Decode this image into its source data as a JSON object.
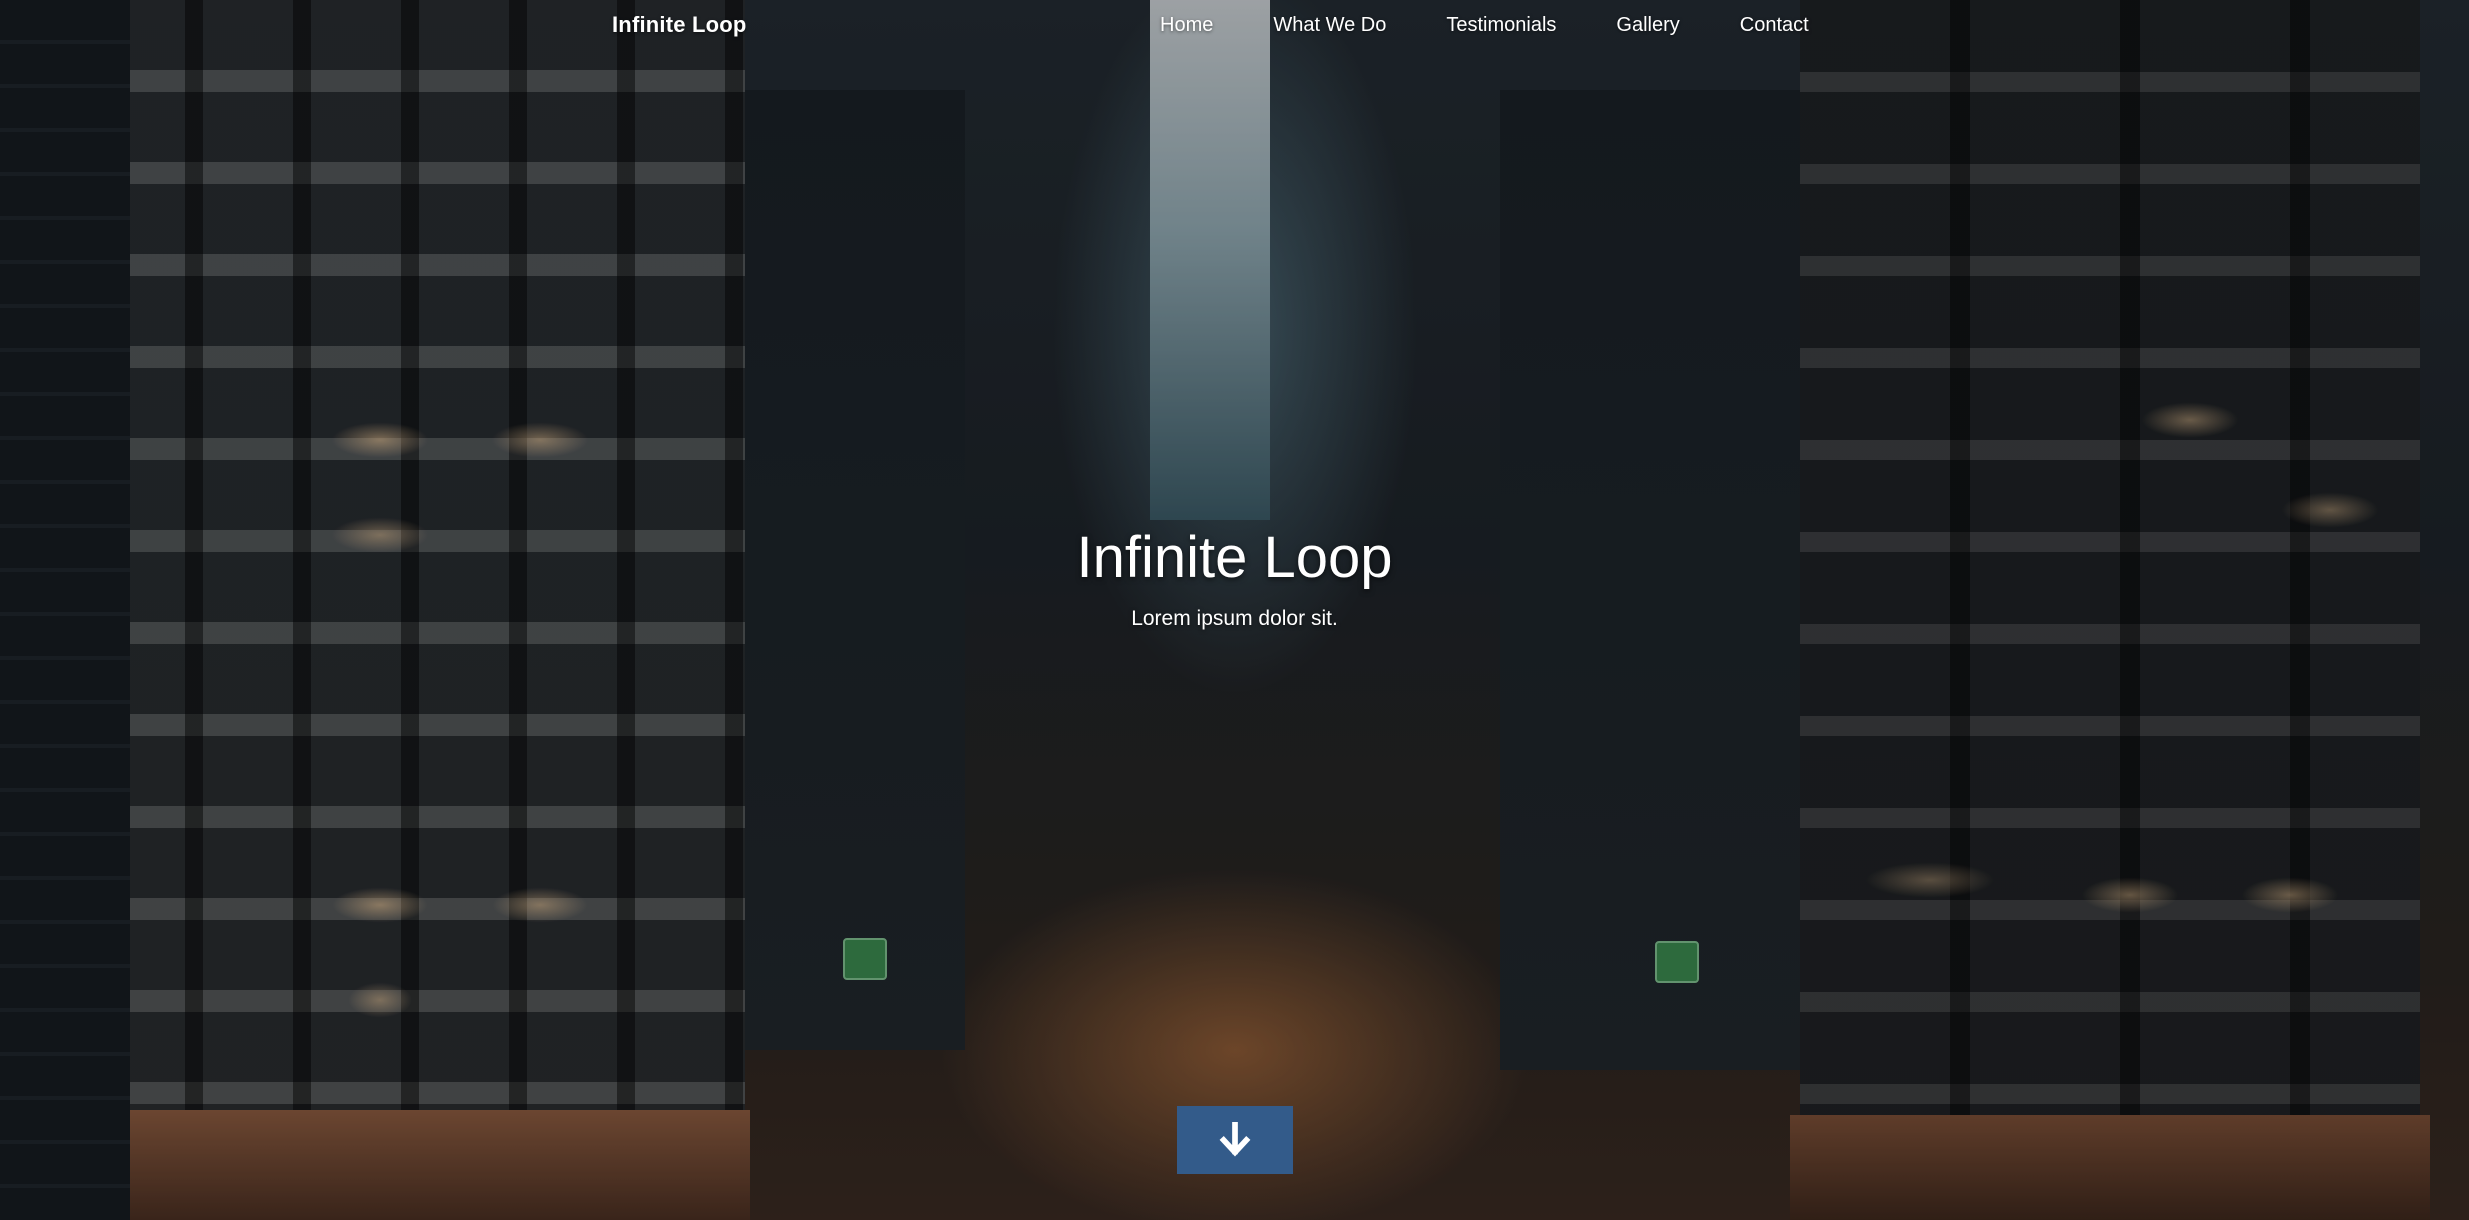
{
  "nav": {
    "brand": "Infinite Loop",
    "links": [
      "Home",
      "What We Do",
      "Testimonials",
      "Gallery",
      "Contact"
    ]
  },
  "hero": {
    "title": "Infinite Loop",
    "subtitle": "Lorem ipsum dolor sit.",
    "scroll_icon": "arrow-down-icon"
  },
  "colors": {
    "accent_button": "#335b8a",
    "text": "#ffffff"
  }
}
